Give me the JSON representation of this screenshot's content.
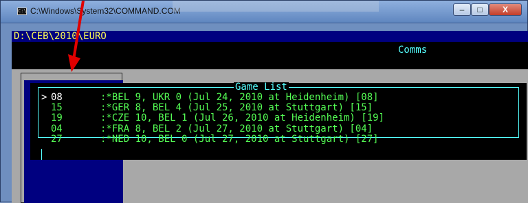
{
  "window": {
    "title": "C:\\Windows\\System32\\COMMAND.COM",
    "controls": {
      "minimize": "–",
      "maximize": "□",
      "close": "X"
    }
  },
  "console": {
    "path": "D:\\CEB\\2010\\EURO",
    "header_label": "Comms"
  },
  "dialog": {
    "title": "Game List",
    "rows": [
      {
        "marker": ">",
        "id": "08",
        "text": ":*BEL 9, UKR 0 (Jul 24, 2010 at Heidenheim) [08]",
        "selected": true
      },
      {
        "marker": "",
        "id": "15",
        "text": ":*GER 8, BEL 4 (Jul 25, 2010 at Stuttgart) [15]",
        "selected": false
      },
      {
        "marker": "",
        "id": "19",
        "text": ":*CZE 10, BEL 1 (Jul 26, 2010 at Heidenheim) [19]",
        "selected": false
      },
      {
        "marker": "",
        "id": "04",
        "text": ":*FRA 8, BEL 2 (Jul 27, 2010 at Stuttgart) [04]",
        "selected": false
      },
      {
        "marker": "",
        "id": "27",
        "text": ":*NED 10, BEL 0 (Jul 27, 2010 at Stuttgart) [27]",
        "selected": false
      }
    ]
  },
  "colors": {
    "path_bar_bg": "#000080",
    "path_text": "#ffff55",
    "list_text": "#55ff55",
    "frame_cyan": "#55ffff",
    "annotation_arrow": "#e00000"
  }
}
